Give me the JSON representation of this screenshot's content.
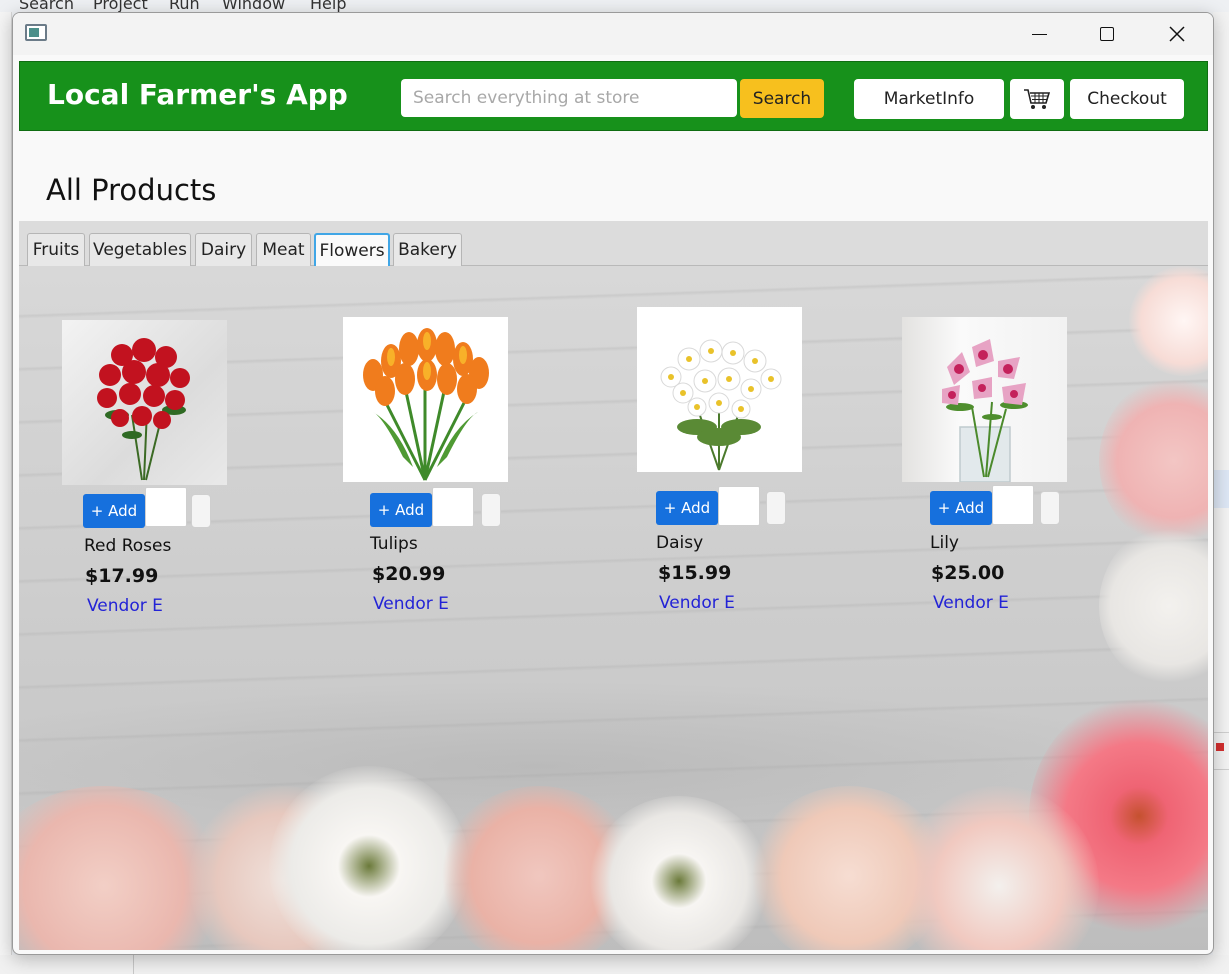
{
  "background": {
    "menubar": [
      "Search",
      "Project",
      "Run",
      "Window",
      "Help"
    ]
  },
  "window": {
    "title": ""
  },
  "header": {
    "brand": "Local Farmer's App",
    "search_placeholder": "Search everything at store",
    "search_button": "Search",
    "market_button": "MarketInfo",
    "cart_icon": "shopping-cart-icon",
    "checkout_button": "Checkout",
    "color": "#17911b",
    "accent": "#f7c01e"
  },
  "page": {
    "title": "All Products"
  },
  "tabs": [
    {
      "label": "Fruits",
      "active": false
    },
    {
      "label": "Vegetables",
      "active": false
    },
    {
      "label": "Dairy",
      "active": false
    },
    {
      "label": "Meat",
      "active": false
    },
    {
      "label": "Flowers",
      "active": true
    },
    {
      "label": "Bakery",
      "active": false
    }
  ],
  "products": [
    {
      "name": "Red Roses",
      "price": "$17.99",
      "vendor": "Vendor E",
      "add_label": "+ Add",
      "qty": ""
    },
    {
      "name": "Tulips",
      "price": "$20.99",
      "vendor": "Vendor E",
      "add_label": "+ Add",
      "qty": ""
    },
    {
      "name": "Daisy",
      "price": "$15.99",
      "vendor": "Vendor E",
      "add_label": "+ Add",
      "qty": ""
    },
    {
      "name": "Lily",
      "price": "$25.00",
      "vendor": "Vendor E",
      "add_label": "+ Add",
      "qty": ""
    }
  ]
}
